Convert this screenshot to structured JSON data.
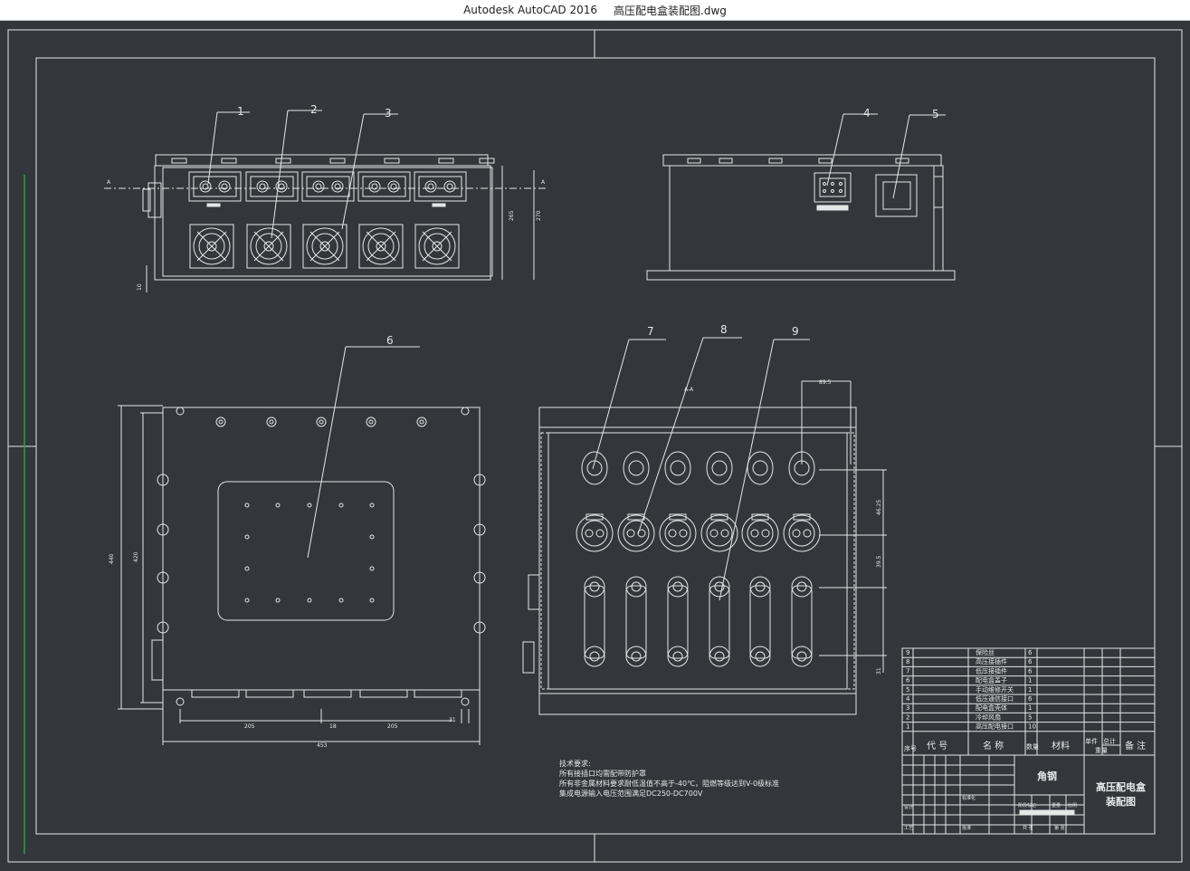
{
  "window": {
    "app_title": "Autodesk AutoCAD 2016",
    "file_name": "高压配电盒装配图.dwg"
  },
  "balloons": [
    "1",
    "2",
    "3",
    "4",
    "5",
    "6",
    "7",
    "8",
    "9"
  ],
  "section_label": "A",
  "dimensions": {
    "front_height_1": "265",
    "front_height_2": "270",
    "front_base": "10",
    "plan_height_1": "440",
    "plan_height_2": "420",
    "plan_width_1": "205",
    "plan_width_2": "18",
    "plan_width_3": "205",
    "plan_width_total": "453",
    "plan_offset": "31",
    "section_top": "89.5",
    "section_right_1": "46.25",
    "section_right_2": "39.5",
    "section_right_3": "31"
  },
  "tech_requirements": {
    "title": "技术要求:",
    "lines": [
      "所有接插口均需配带防护罩",
      "所有非金属材料要求耐低温值不高于-40℃，阻燃等级达到V-0级标准",
      "集成电源输入电压范围满足DC250-DC700V"
    ]
  },
  "bom": {
    "rows": [
      {
        "no": "9",
        "name": "保险丝",
        "qty": "6"
      },
      {
        "no": "8",
        "name": "高压接插件",
        "qty": "6"
      },
      {
        "no": "7",
        "name": "低压接插件",
        "qty": "6"
      },
      {
        "no": "6",
        "name": "配电盒盖子",
        "qty": "1"
      },
      {
        "no": "5",
        "name": "手动维修开关",
        "qty": "1"
      },
      {
        "no": "4",
        "name": "低压通信接口",
        "qty": "6"
      },
      {
        "no": "3",
        "name": "配电盒壳体",
        "qty": "1"
      },
      {
        "no": "2",
        "name": "冷却风扇",
        "qty": "5"
      },
      {
        "no": "1",
        "name": "高压配电接口",
        "qty": "10"
      }
    ],
    "header": {
      "seq": "序号",
      "code": "代 号",
      "name": "名 称",
      "qty": "数量",
      "material": "材料",
      "unit_weight": "单件",
      "total_weight": "总计",
      "weight": "重量",
      "note": "备 注"
    }
  },
  "title_block": {
    "material": "角钢",
    "drawing_name_1": "高压配电盒",
    "drawing_name_2": "装配图",
    "design": "设计",
    "standard": "标准化",
    "stage": "阶段标记",
    "weight": "重量",
    "scale": "比例",
    "process": "工艺",
    "approve": "批准",
    "sheets": "共 张",
    "sheet": "第 张"
  }
}
